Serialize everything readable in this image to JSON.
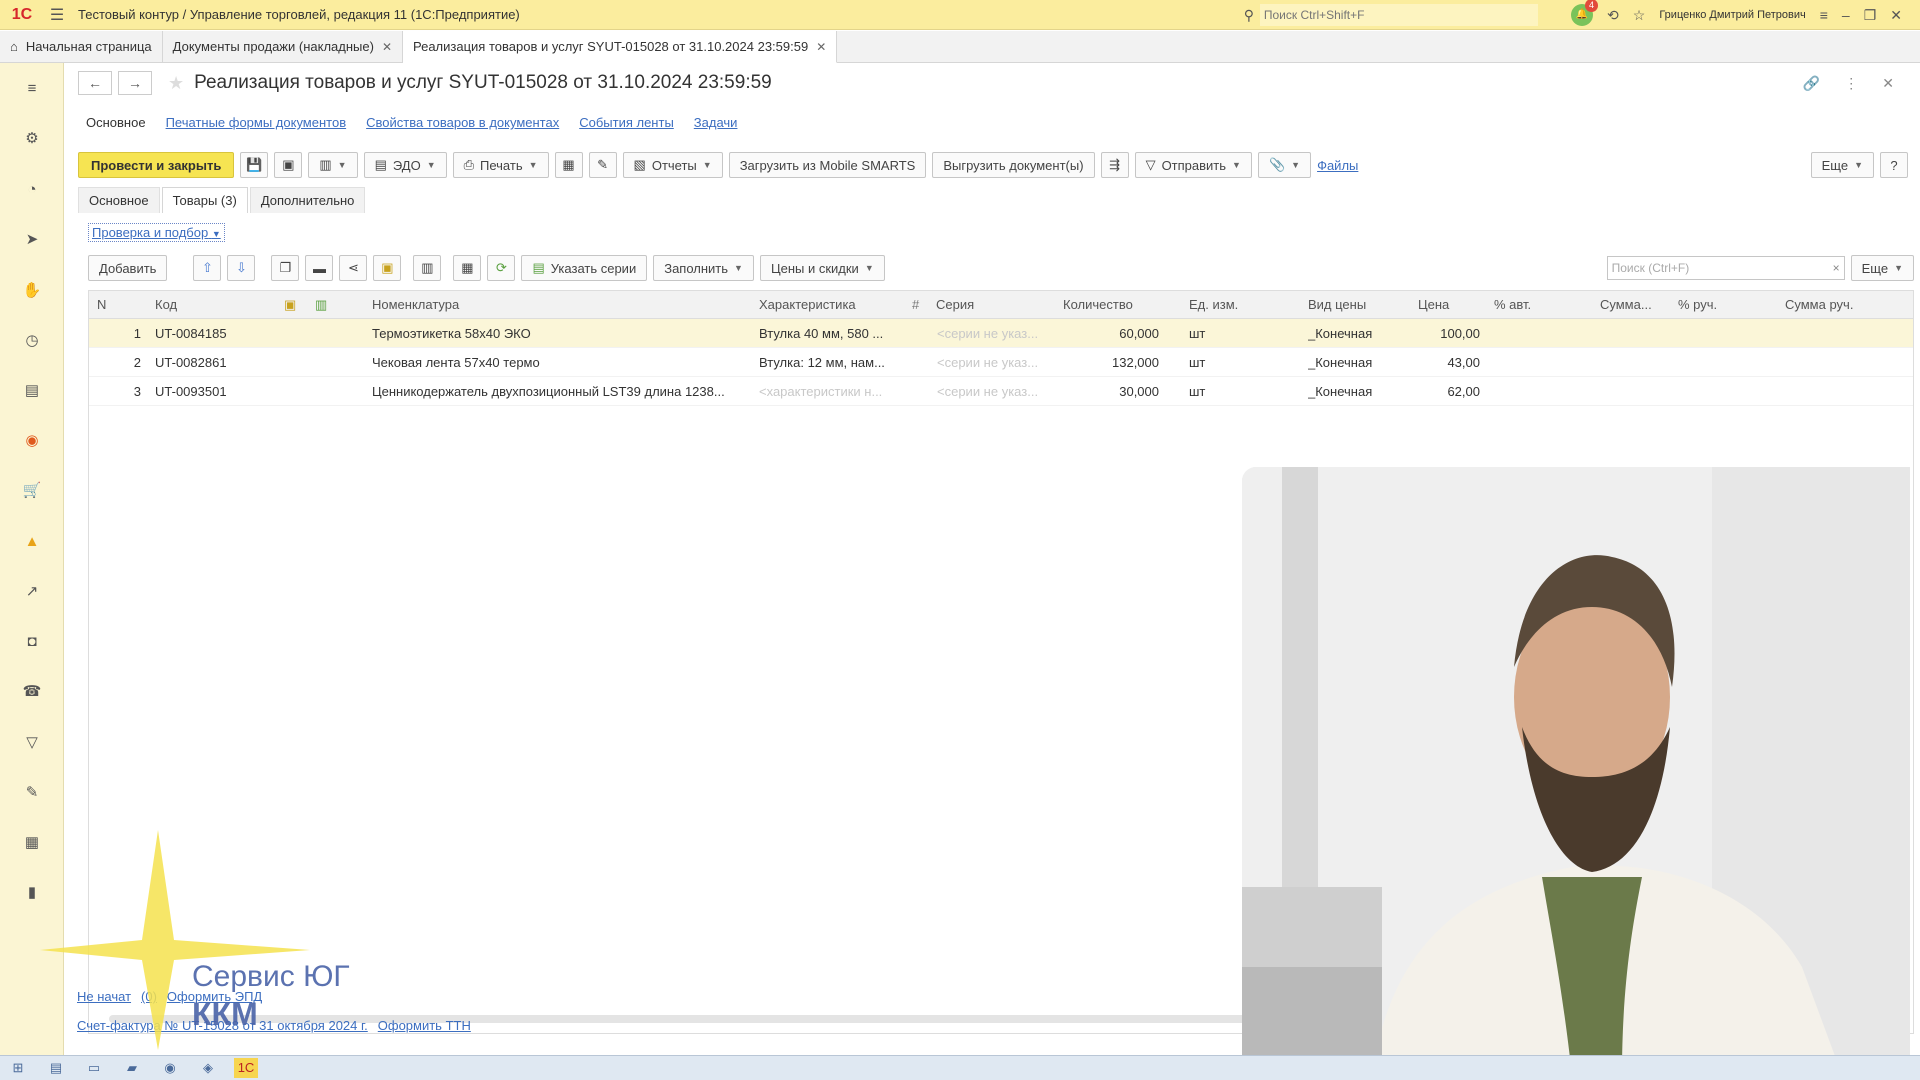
{
  "topbar": {
    "logo": "1С",
    "title": "Тестовый контур / Управление торговлей, редакция 11  (1С:Предприятие)",
    "search_placeholder": "Поиск Ctrl+Shift+F",
    "notifications_count": "4",
    "user": "Гриценко Дмитрий Петрович"
  },
  "tabs": [
    {
      "label": "Начальная страница"
    },
    {
      "label": "Документы продажи (накладные)"
    },
    {
      "label": "Реализация товаров и услуг SYUT-015028 от 31.10.2024 23:59:59"
    }
  ],
  "document": {
    "title": "Реализация товаров и услуг SYUT-015028 от 31.10.2024 23:59:59",
    "sublinks": [
      "Основное",
      "Печатные формы документов",
      "Свойства товаров в документах",
      "События ленты",
      "Задачи"
    ]
  },
  "toolbar": {
    "post_close": "Провести и закрыть",
    "edo": "ЭДО",
    "print": "Печать",
    "reports": "Отчеты",
    "load_mobile": "Загрузить из Mobile SMARTS",
    "export_docs": "Выгрузить документ(ы)",
    "send": "Отправить",
    "files": "Файлы",
    "more": "Еще",
    "help": "?"
  },
  "inner_tabs": [
    "Основное",
    "Товары (3)",
    "Дополнительно"
  ],
  "check_link": "Проверка и подбор",
  "table_toolbar": {
    "add": "Добавить",
    "series": "Указать серии",
    "fill": "Заполнить",
    "prices": "Цены и скидки",
    "search_placeholder": "Поиск (Ctrl+F)",
    "more": "Еще"
  },
  "table": {
    "headers": {
      "n": "N",
      "code": "Код",
      "nomen": "Номенклатура",
      "char": "Характеристика",
      "series": "Серия",
      "qty": "Количество",
      "unit": "Ед. изм.",
      "pricetype": "Вид цены",
      "price": "Цена",
      "pct_auto": "% авт.",
      "sum_auto": "Сумма...",
      "pct_man": "% руч.",
      "sum_man": "Сумма руч."
    },
    "rows": [
      {
        "n": "1",
        "code": "UT-0084185",
        "nomen": "Термоэтикетка 58х40 ЭКО",
        "char": "Втулка 40 мм, 580 ...",
        "series": "<серии не указ...",
        "qty": "60,000",
        "unit": "шт",
        "pricetype": "_Конечная",
        "price": "100,00"
      },
      {
        "n": "2",
        "code": "UT-0082861",
        "nomen": "Чековая лента 57х40 термо",
        "char": "Втулка: 12 мм, нам...",
        "series": "<серии не указ...",
        "qty": "132,000",
        "unit": "шт",
        "pricetype": "_Конечная",
        "price": "43,00"
      },
      {
        "n": "3",
        "code": "UT-0093501",
        "nomen": "Ценникодержатель двухпозиционный LST39 длина 1238...",
        "char": "<характеристики н...",
        "series": "<серии не указ...",
        "qty": "30,000",
        "unit": "шт",
        "pricetype": "_Конечная",
        "price": "62,00"
      }
    ]
  },
  "footer": {
    "status": "Не начат",
    "count": "(0)",
    "edo_link": "Оформить ЭПД",
    "invoice": "Счет-фактура № UT-15028 от 31 октября 2024 г.",
    "ttn": "Оформить ТТН"
  },
  "watermark": {
    "line1": "Сервис ЮГ",
    "line2": "ККМ"
  },
  "colors": {
    "accent": "#f6e452",
    "topbar": "#fbed9e",
    "link": "#3c6ec0"
  }
}
